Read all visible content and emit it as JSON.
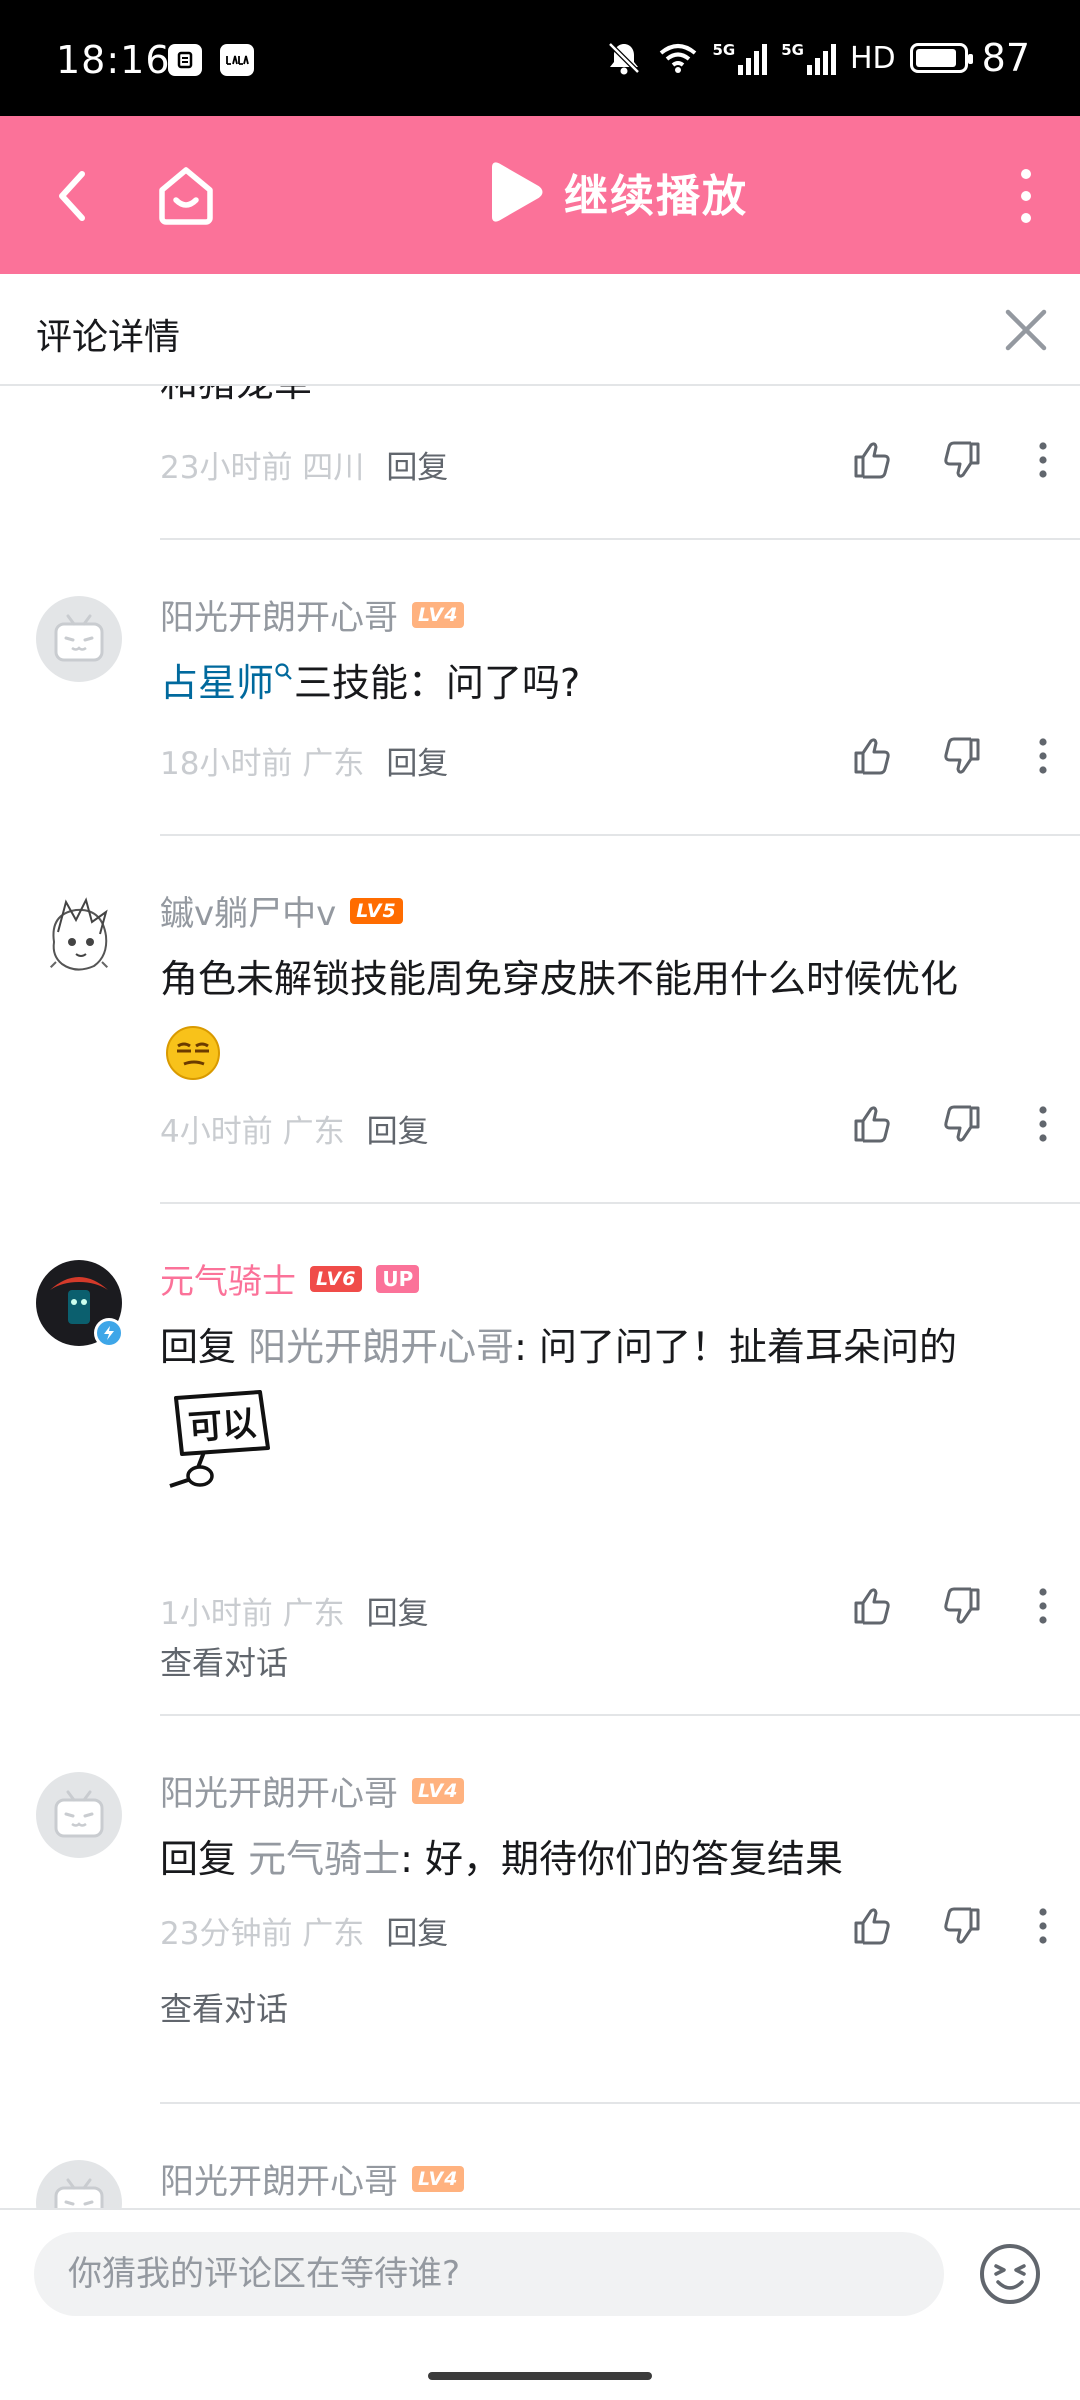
{
  "status_bar": {
    "time": "18:16",
    "left_icons": [
      "notification-app-icon",
      "lala-app-icon"
    ],
    "right_texts": {
      "sim1": "5G",
      "sim2": "5G",
      "hd": "HD"
    },
    "battery": "87",
    "battery_level": 0.87
  },
  "header": {
    "play_label": "继续播放",
    "accent_color": "#fb7299"
  },
  "detail": {
    "title": "评论详情"
  },
  "comments": [
    {
      "content_partial": "和猪宠草",
      "time": "23小时前 四川",
      "reply_label": "回复"
    },
    {
      "username": "阳光开朗开心哥",
      "level": "LV4",
      "content_link": "占星师",
      "content_rest": "三技能：问了吗?",
      "time": "18小时前 广东",
      "reply_label": "回复"
    },
    {
      "username": "鏚v躺尸中v",
      "level": "LV5",
      "content": "角色未解锁技能周免穿皮肤不能用什么时候优化",
      "time": "4小时前 广东",
      "reply_label": "回复"
    },
    {
      "username": "元气骑士",
      "level": "LV6",
      "up_badge": "UP",
      "reply_prefix": "回复",
      "reply_to": "阳光开朗开心哥",
      "content": ": 问了问了！扯着耳朵问的",
      "sticker_text": "可以",
      "time": "1小时前 广东",
      "reply_label": "回复",
      "view_conversation": "查看对话"
    },
    {
      "username": "阳光开朗开心哥",
      "level": "LV4",
      "reply_prefix": "回复",
      "reply_to": "元气骑士",
      "content": ": 好，期待你们的答复结果",
      "time": "23分钟前 广东",
      "reply_label": "回复",
      "view_conversation": "查看对话"
    },
    {
      "username": "阳光开朗开心哥",
      "level": "LV4"
    }
  ],
  "input": {
    "placeholder": "你猜我的评论区在等待谁?"
  }
}
